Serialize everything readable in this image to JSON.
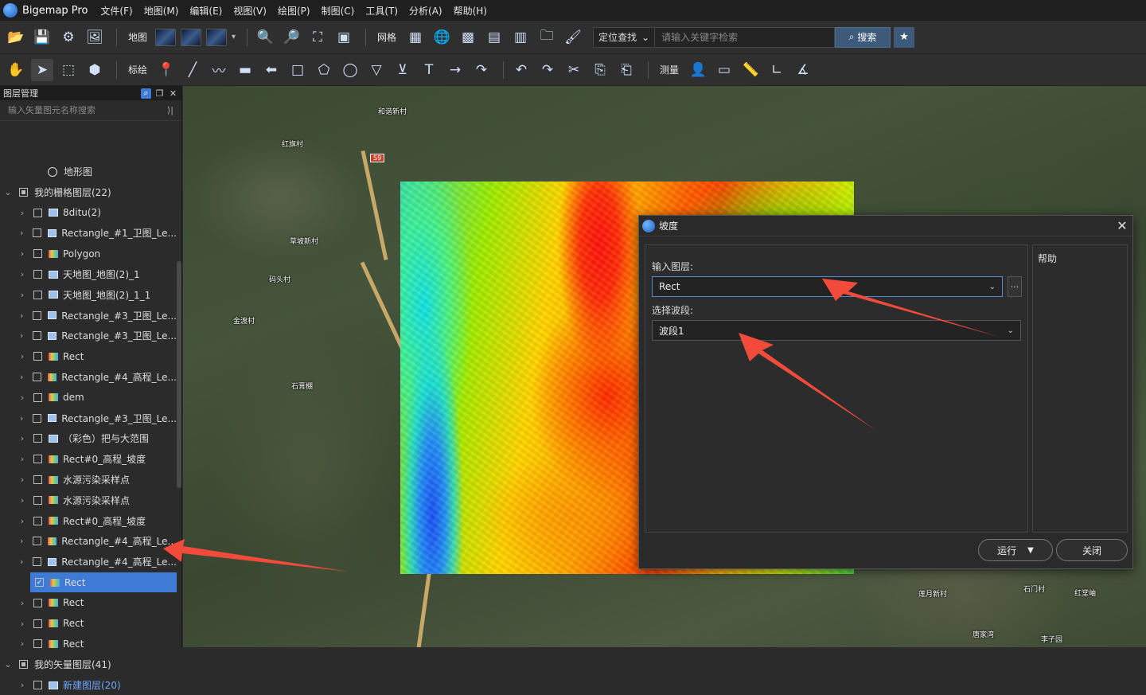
{
  "app": {
    "title": "Bigemap Pro"
  },
  "menu": [
    "文件(F)",
    "地图(M)",
    "编辑(E)",
    "视图(V)",
    "绘图(P)",
    "制图(C)",
    "工具(T)",
    "分析(A)",
    "帮助(H)"
  ],
  "toolbar1": {
    "map_label": "地图",
    "grid_label": "网格",
    "search_mode": "定位查找",
    "search_placeholder": "请输入关键字检索",
    "search_button": "搜索"
  },
  "toolbar2": {
    "annotate_label": "标绘",
    "measure_label": "测量"
  },
  "layer_panel": {
    "title": "图层管理",
    "search_placeholder": "输入矢量图元名称搜索",
    "terrain_item": "地形图",
    "raster_group": "我的栅格图层(22)",
    "raster_layers": [
      {
        "name": "8ditu(2)",
        "icon": "img",
        "checked": false
      },
      {
        "name": "Rectangle_#1_卫图_Le...",
        "icon": "img",
        "checked": false
      },
      {
        "name": "Polygon",
        "icon": "grad",
        "checked": false
      },
      {
        "name": "天地图_地图(2)_1",
        "icon": "img",
        "checked": false
      },
      {
        "name": "天地图_地图(2)_1_1",
        "icon": "img",
        "checked": false
      },
      {
        "name": "Rectangle_#3_卫图_Le...",
        "icon": "img",
        "checked": false
      },
      {
        "name": "Rectangle_#3_卫图_Le...",
        "icon": "img",
        "checked": false
      },
      {
        "name": "Rect",
        "icon": "grad",
        "checked": false
      },
      {
        "name": "Rectangle_#4_高程_Le...",
        "icon": "grad",
        "checked": false
      },
      {
        "name": "dem",
        "icon": "grad",
        "checked": false
      },
      {
        "name": "Rectangle_#3_卫图_Le...",
        "icon": "img",
        "checked": false
      },
      {
        "name": "（彩色）把与大范围",
        "icon": "img",
        "checked": false
      },
      {
        "name": "Rect#0_高程_坡度",
        "icon": "grad",
        "checked": false
      },
      {
        "name": "水源污染采样点",
        "icon": "grad",
        "checked": false
      },
      {
        "name": "水源污染采样点",
        "icon": "grad",
        "checked": false
      },
      {
        "name": "Rect#0_高程_坡度",
        "icon": "grad",
        "checked": false
      },
      {
        "name": "Rectangle_#4_高程_Le...",
        "icon": "grad",
        "checked": false
      },
      {
        "name": "Rectangle_#4_高程_Le...",
        "icon": "img",
        "checked": false
      },
      {
        "name": "Rect",
        "icon": "grad",
        "checked": true
      },
      {
        "name": "Rect",
        "icon": "grad",
        "checked": false
      },
      {
        "name": "Rect",
        "icon": "grad",
        "checked": false
      },
      {
        "name": "Rect",
        "icon": "grad",
        "checked": false
      }
    ],
    "vector_group": "我的矢量图层(41)",
    "vector_sub": "新建图层(20)"
  },
  "map_labels": {
    "p1": "和谐新村",
    "p2": "红旗村",
    "p3": "草坡新村",
    "p4": "码头村",
    "p5": "金渡村",
    "p6": "石膏棚",
    "p7": "莲月新村",
    "p8": "石门村",
    "p9": "红堂岫",
    "p10": "唐家湾",
    "p11": "李子园",
    "road": "S9"
  },
  "dialog": {
    "title": "坡度",
    "input_layer_label": "输入图层:",
    "input_layer_value": "Rect",
    "band_label": "选择波段:",
    "band_value": "波段1",
    "help_label": "帮助",
    "run_button": "运行",
    "close_button": "关闭"
  }
}
